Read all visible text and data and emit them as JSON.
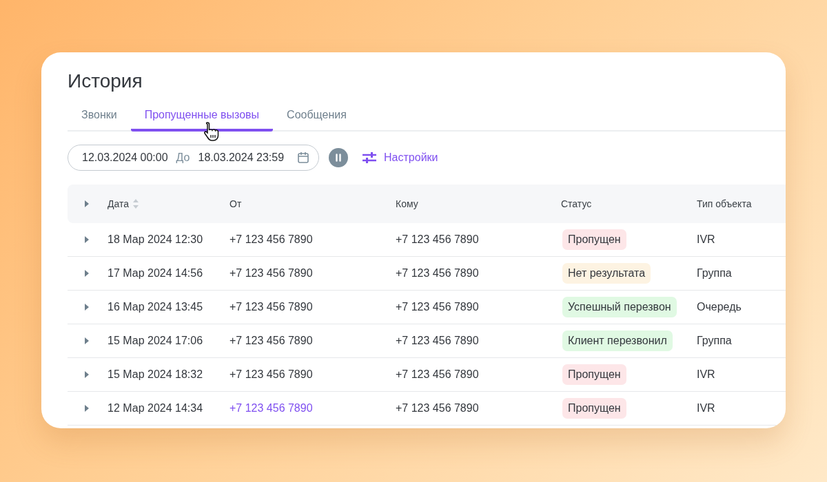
{
  "title": "История",
  "tabs": [
    {
      "label": "Звонки",
      "selected": false
    },
    {
      "label": "Пропущенные вызовы",
      "selected": true
    },
    {
      "label": "Сообщения",
      "selected": false
    }
  ],
  "filter": {
    "from": "12.03.2024 00:00",
    "separator": "До",
    "to": "18.03.2024 23:59",
    "settings": "Настройки"
  },
  "table": {
    "columns": [
      "Дата",
      "От",
      "Кому",
      "Статус",
      "Тип объекта"
    ],
    "rows": [
      {
        "date": "18 Мар 2024 12:30",
        "from": "+7 123 456 7890",
        "from_highlighted": false,
        "to": "+7 123 456 7890",
        "status": {
          "label": "Пропущен",
          "color": "#fde6e8"
        },
        "type": "IVR"
      },
      {
        "date": "17 Мар 2024 14:56",
        "from": "+7 123 456 7890",
        "from_highlighted": false,
        "to": "+7 123 456 7890",
        "status": {
          "label": "Нет результата",
          "color": "#fdf3e2"
        },
        "type": "Группа"
      },
      {
        "date": "16 Мар 2024 13:45",
        "from": "+7 123 456 7890",
        "from_highlighted": false,
        "to": "+7 123 456 7890",
        "status": {
          "label": "Успешный перезвон",
          "color": "#e0f9e3"
        },
        "type": "Очередь"
      },
      {
        "date": "15 Мар 2024 17:06",
        "from": "+7 123 456 7890",
        "from_highlighted": false,
        "to": "+7 123 456 7890",
        "status": {
          "label": "Клиент перезвонил",
          "color": "#e0f9e3"
        },
        "type": "Группа"
      },
      {
        "date": "15 Мар 2024 18:32",
        "from": "+7 123 456 7890",
        "from_highlighted": false,
        "to": "+7 123 456 7890",
        "status": {
          "label": "Пропущен",
          "color": "#fde6e8"
        },
        "type": "IVR"
      },
      {
        "date": "12 Мар 2024 14:34",
        "from": "+7 123 456 7890",
        "from_highlighted": true,
        "to": "+7 123 456 7890",
        "status": {
          "label": "Пропущен",
          "color": "#fde6e8"
        },
        "type": "IVR"
      }
    ]
  }
}
